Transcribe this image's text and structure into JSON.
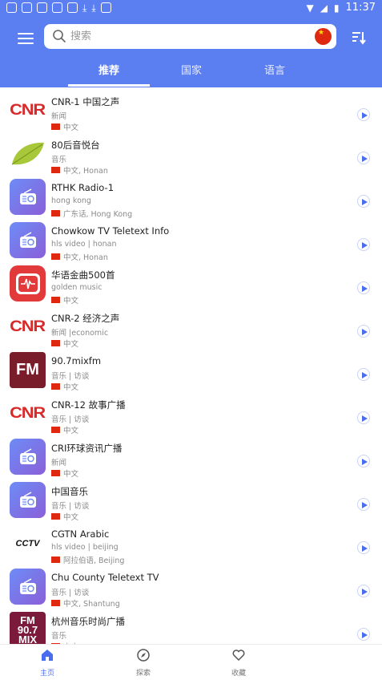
{
  "status": {
    "time": "11:37"
  },
  "search": {
    "placeholder": "搜索"
  },
  "tabs": [
    {
      "label": "推荐"
    },
    {
      "label": "国家"
    },
    {
      "label": "语言"
    }
  ],
  "stations": [
    {
      "title": "CNR-1 中国之声",
      "sub": "新闻",
      "lang": "中文",
      "thumb": "cnr",
      "thumb_text": "CNR"
    },
    {
      "title": "80后音悦台",
      "sub": "音乐",
      "lang": "中文, Honan",
      "thumb": "leaf"
    },
    {
      "title": "RTHK Radio-1",
      "sub": "hong kong",
      "lang": "广东话, Hong Kong",
      "thumb": "radio"
    },
    {
      "title": "Chowkow TV Teletext Info",
      "sub": "hls video | honan",
      "lang": "中文, Honan",
      "thumb": "radio"
    },
    {
      "title": "华语金曲500首",
      "sub": "golden music",
      "lang": "中文",
      "thumb": "redbox"
    },
    {
      "title": "CNR-2 经济之声",
      "sub": "新闻 |economic",
      "lang": "中文",
      "thumb": "cnr",
      "thumb_text": "CNR"
    },
    {
      "title": "90.7mixfm",
      "sub": "音乐 | 访谈",
      "lang": "中文",
      "thumb": "fm",
      "thumb_text": "FM"
    },
    {
      "title": "CNR-12 故事广播",
      "sub": "音乐 | 访谈",
      "lang": "中文",
      "thumb": "cnr",
      "thumb_text": "CNR"
    },
    {
      "title": "CRI环球资讯广播",
      "sub": "新闻",
      "lang": "中文",
      "thumb": "radio"
    },
    {
      "title": "中国音乐",
      "sub": "音乐 | 访谈",
      "lang": "中文",
      "thumb": "radio"
    },
    {
      "title": "CGTN Arabic",
      "sub": "hls video | beijing",
      "lang": "阿拉伯语, Beijing",
      "thumb": "cctv",
      "thumb_text": "CCTV"
    },
    {
      "title": "Chu County Teletext TV",
      "sub": "音乐 | 访谈",
      "lang": "中文, Shantung",
      "thumb": "radio"
    },
    {
      "title": "杭州音乐时尚广播",
      "sub": "音乐",
      "lang": "中文",
      "thumb": "mix",
      "thumb_text": "FM 90.7 MIX"
    }
  ],
  "bottom_nav": [
    {
      "label": "主页",
      "icon": "home-icon"
    },
    {
      "label": "探索",
      "icon": "compass-icon"
    },
    {
      "label": "收藏",
      "icon": "heart-icon"
    }
  ],
  "colors": {
    "accent": "#5b7ff0",
    "play": "#4a6cf0"
  }
}
